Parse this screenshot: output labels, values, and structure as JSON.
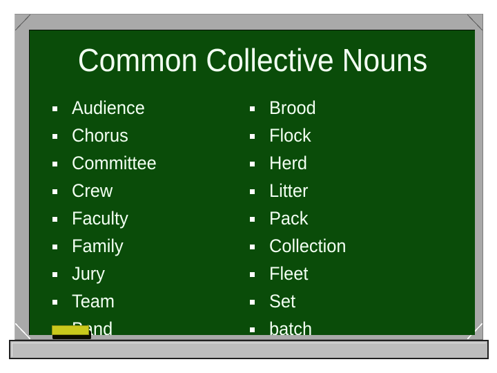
{
  "slide": {
    "title": "Common Collective Nouns",
    "board_color": "#0a4c09",
    "frame_color": "#a9a9a9",
    "tray_color": "#bdbdbd",
    "text_color": "#f2fff2",
    "chalk_color": "#c9c91c",
    "bullet_glyph": "square-bullet"
  },
  "columns": {
    "left": {
      "name": "left-noun-column",
      "items": [
        {
          "label": "Audience"
        },
        {
          "label": "Chorus"
        },
        {
          "label": "Committee"
        },
        {
          "label": "Crew"
        },
        {
          "label": "Faculty"
        },
        {
          "label": "Family"
        },
        {
          "label": "Jury"
        },
        {
          "label": "Team"
        },
        {
          "label": "Band"
        }
      ]
    },
    "right": {
      "name": "right-noun-column",
      "items": [
        {
          "label": "Brood"
        },
        {
          "label": "Flock"
        },
        {
          "label": "Herd"
        },
        {
          "label": "Litter"
        },
        {
          "label": "Pack"
        },
        {
          "label": "Collection"
        },
        {
          "label": "Fleet"
        },
        {
          "label": "Set"
        },
        {
          "label": "batch"
        }
      ]
    }
  }
}
